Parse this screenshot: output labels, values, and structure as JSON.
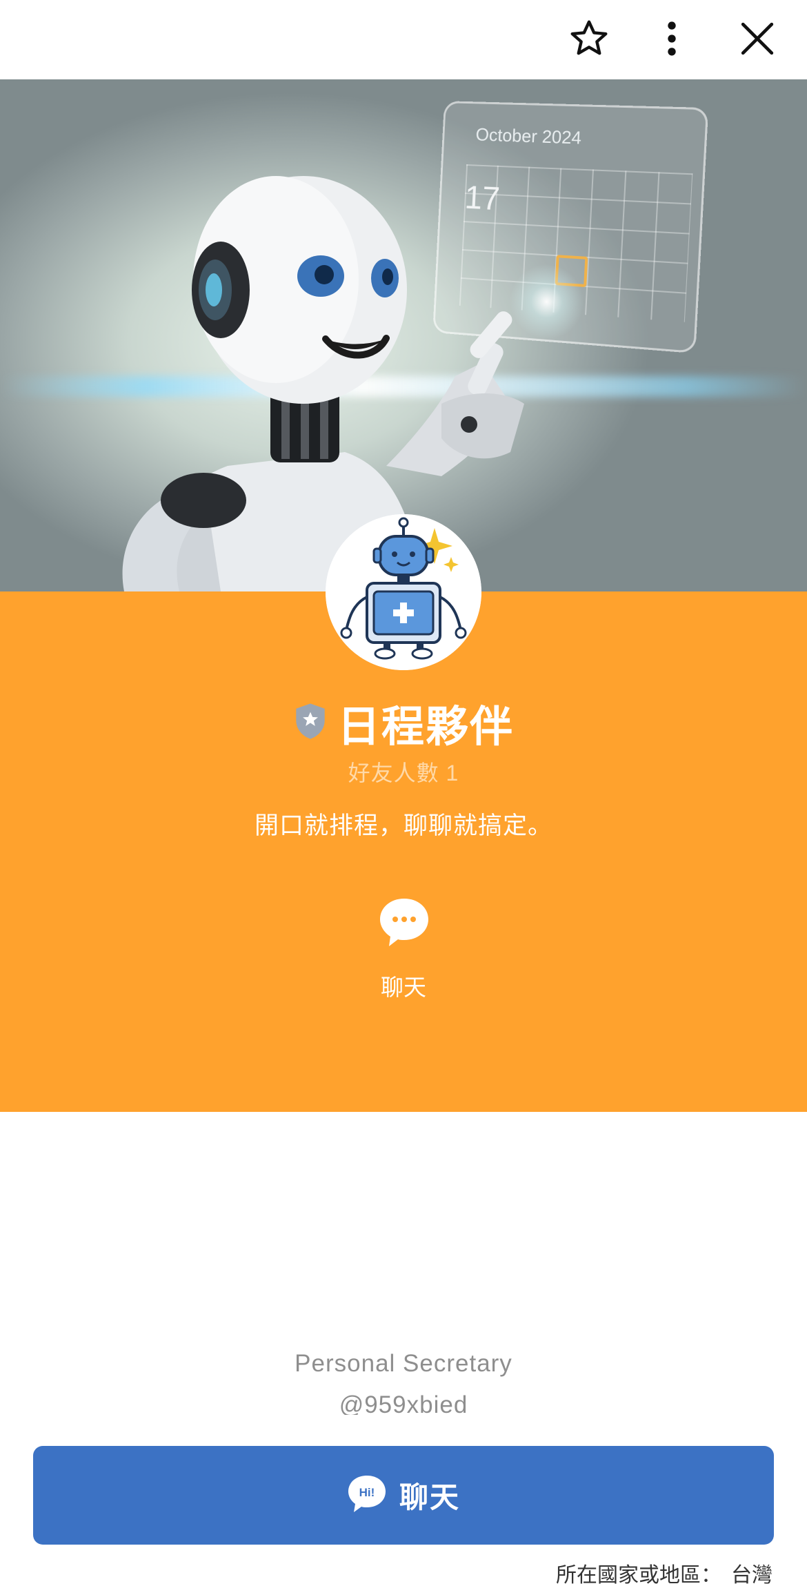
{
  "header": {
    "favorite_icon": "star-outline-icon",
    "more_icon": "vertical-dots-icon",
    "close_icon": "close-x-icon"
  },
  "cover": {
    "calendar_title": "October 2024",
    "calendar_day": "17",
    "highlighted_date": "17"
  },
  "profile": {
    "avatar": "robot-calendar-avatar",
    "verified_badge": "shield-star-badge",
    "name": "日程夥伴",
    "friends": "好友人數 1",
    "tagline": "開口就排程，聊聊就搞定。",
    "chat_action_label": "聊天",
    "category": "Personal Secretary",
    "handle": "@959xbied"
  },
  "cta": {
    "label": "聊天",
    "icon": "hi-chat-bubble-icon"
  },
  "region": {
    "label": "所在國家或地區：",
    "value": "台灣"
  },
  "colors": {
    "band": "#ffa22d",
    "cta": "#3c72c4"
  }
}
